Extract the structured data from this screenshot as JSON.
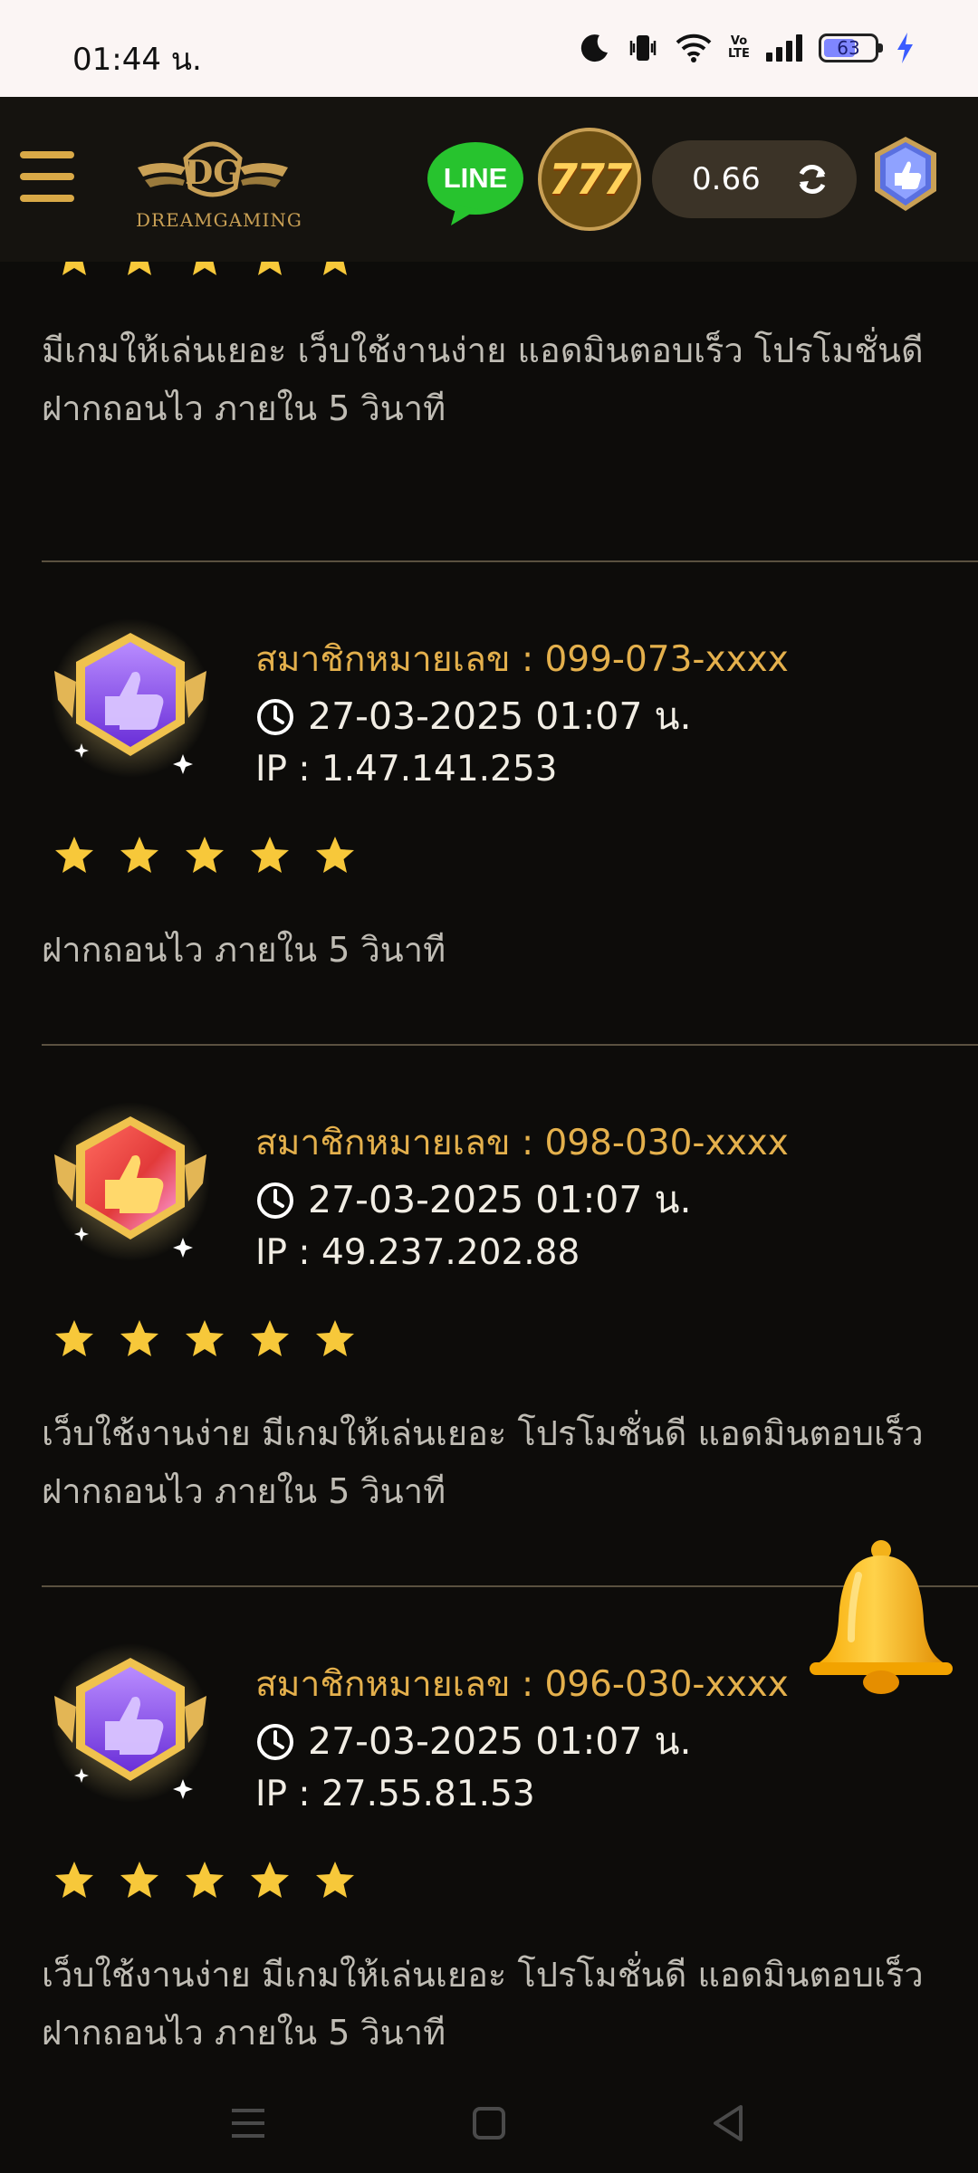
{
  "status_bar": {
    "time": "01:44 น.",
    "battery_level": 63,
    "battery_text": "63",
    "volte": "Vo LTE"
  },
  "header": {
    "logo_text": "DREAMGAMING",
    "line_label": "LINE",
    "slot_label": "777",
    "balance": "0.66"
  },
  "reviews": [
    {
      "rating": 5,
      "text_lines": [
        "มีเกมให้เล่นเยอะ เว็บใช้งานง่าย แอดมินตอบเร็ว โปรโมชั่นดี",
        "ฝากถอนไว ภายใน 5 วินาที"
      ]
    },
    {
      "member": "สมาชิกหมายเลข : 099-073-xxxx",
      "time": "27-03-2025 01:07 น.",
      "ip": "IP : 1.47.141.253",
      "badge": "purple",
      "rating": 5,
      "text_lines": [
        "ฝากถอนไว ภายใน 5 วินาที"
      ]
    },
    {
      "member": "สมาชิกหมายเลข : 098-030-xxxx",
      "time": "27-03-2025 01:07 น.",
      "ip": "IP : 49.237.202.88",
      "badge": "red",
      "rating": 5,
      "text_lines": [
        "เว็บใช้งานง่าย มีเกมให้เล่นเยอะ โปรโมชั่นดี แอดมินตอบเร็ว",
        "ฝากถอนไว ภายใน 5 วินาที"
      ]
    },
    {
      "member": "สมาชิกหมายเลข : 096-030-xxxx",
      "time": "27-03-2025 01:07 น.",
      "ip": "IP : 27.55.81.53",
      "badge": "purple",
      "rating": 5,
      "text_lines": [
        "เว็บใช้งานง่าย มีเกมให้เล่นเยอะ โปรโมชั่นดี แอดมินตอบเร็ว",
        "ฝากถอนไว ภายใน 5 วินาที"
      ]
    }
  ],
  "icons": {
    "menu": "hamburger-menu-icon",
    "refresh": "refresh-icon",
    "clock": "clock-icon",
    "star": "star-icon",
    "bell": "bell-icon",
    "badge": "thumbs-up-badge-icon"
  },
  "colors": {
    "gold": "#e4b04c",
    "star": "#f7c83a",
    "background": "#0d0c0a",
    "header": "#15130f",
    "badge_purple": "#8b55f0",
    "badge_red": "#e23a3a"
  }
}
